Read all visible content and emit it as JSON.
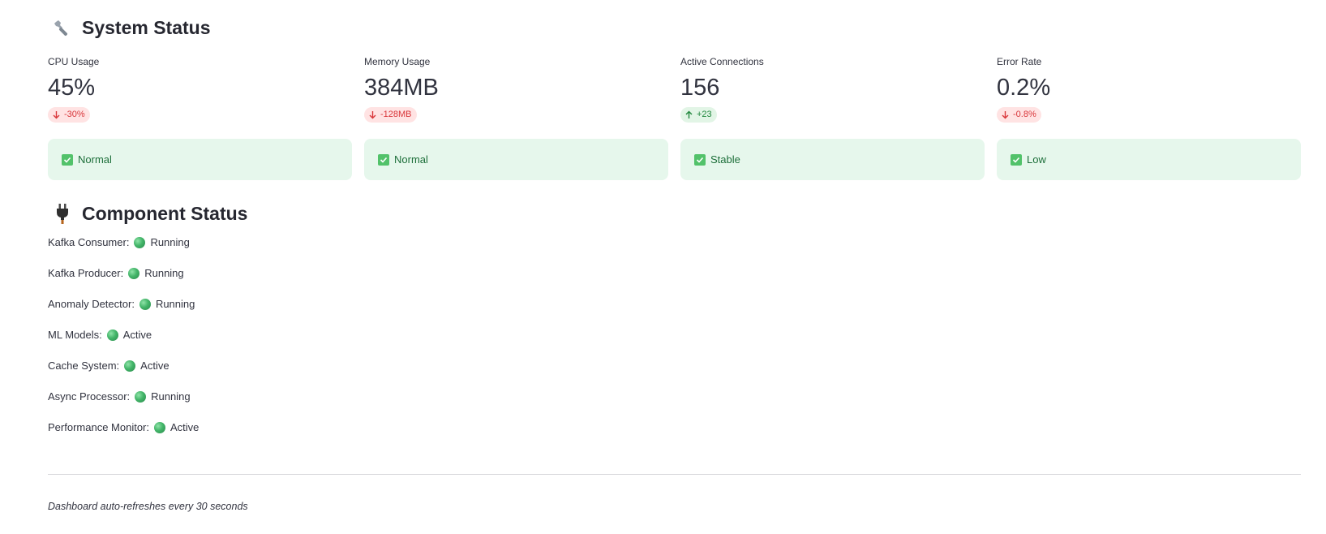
{
  "system_status": {
    "icon": "wrench-icon",
    "title": "System Status",
    "metrics": [
      {
        "label": "CPU Usage",
        "value": "45%",
        "delta": "-30%",
        "direction": "down",
        "status": "Normal"
      },
      {
        "label": "Memory Usage",
        "value": "384MB",
        "delta": "-128MB",
        "direction": "down",
        "status": "Normal"
      },
      {
        "label": "Active Connections",
        "value": "156",
        "delta": "+23",
        "direction": "up",
        "status": "Stable"
      },
      {
        "label": "Error Rate",
        "value": "0.2%",
        "delta": "-0.8%",
        "direction": "down",
        "status": "Low"
      }
    ]
  },
  "component_status": {
    "icon": "plug-icon",
    "title": "Component Status",
    "items": [
      {
        "name": "Kafka Consumer:",
        "state": "Running"
      },
      {
        "name": "Kafka Producer:",
        "state": "Running"
      },
      {
        "name": "Anomaly Detector:",
        "state": "Running"
      },
      {
        "name": "ML Models:",
        "state": "Active"
      },
      {
        "name": "Cache System:",
        "state": "Active"
      },
      {
        "name": "Async Processor:",
        "state": "Running"
      },
      {
        "name": "Performance Monitor:",
        "state": "Active"
      }
    ]
  },
  "footer": {
    "note": "Dashboard auto-refreshes every 30 seconds"
  },
  "colors": {
    "success_bg": "#e6f7ec",
    "success_text": "#1d6f3a",
    "delta_down": "#d9373b",
    "delta_up": "#21873d",
    "status_dot": "#43b569"
  }
}
